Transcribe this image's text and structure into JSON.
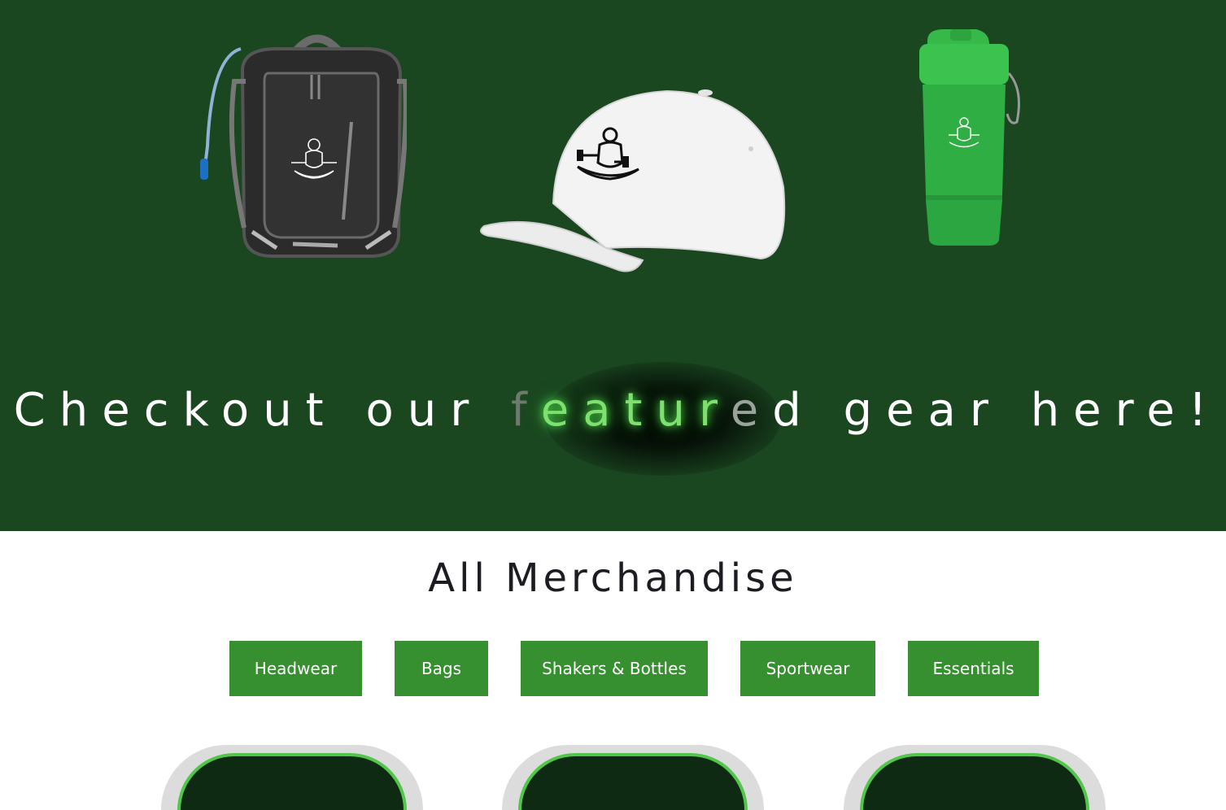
{
  "hero": {
    "products": [
      {
        "name": "backpack",
        "icon": "backpack-image"
      },
      {
        "name": "cap",
        "icon": "cap-image"
      },
      {
        "name": "shaker",
        "icon": "shaker-bottle-image"
      }
    ],
    "title_before": "Checkout our ",
    "title_fade1": "f",
    "title_lit": "eatur",
    "title_fade2": "e",
    "title_after": "d gear here!",
    "background_color": "#1a4620",
    "glow_color": "#7ee06e"
  },
  "merch": {
    "title": "All Merchandise",
    "categories": [
      "Headwear",
      "Bags",
      "Shakers & Bottles",
      "Sportwear",
      "Essentials"
    ],
    "button_color": "#36902f"
  }
}
